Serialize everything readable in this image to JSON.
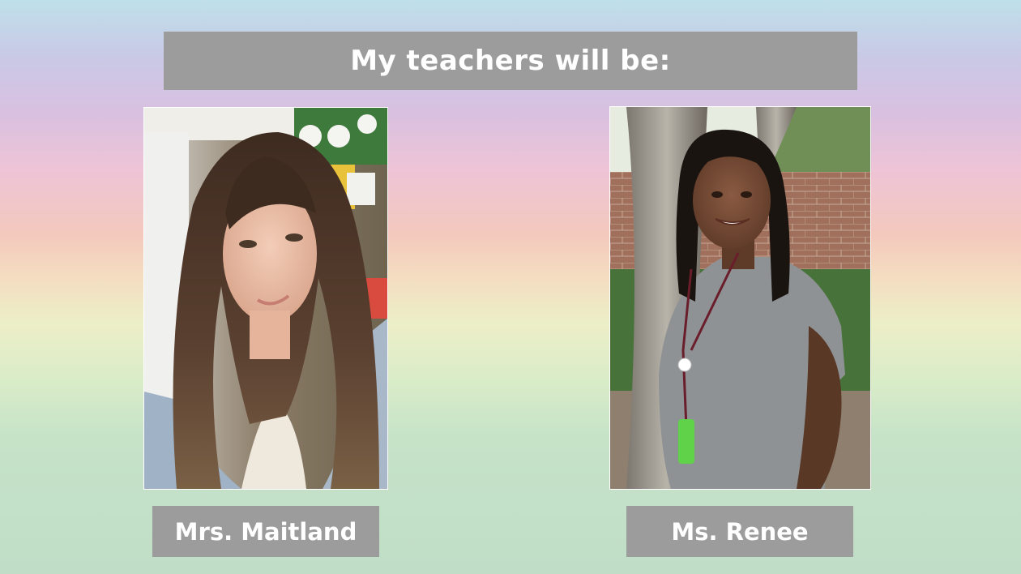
{
  "slide": {
    "title": "My teachers will be:",
    "teachers": [
      {
        "name": "Mrs. Maitland"
      },
      {
        "name": "Ms. Renee"
      }
    ]
  },
  "colors": {
    "bar": "#9c9c9c",
    "text": "#ffffff"
  }
}
